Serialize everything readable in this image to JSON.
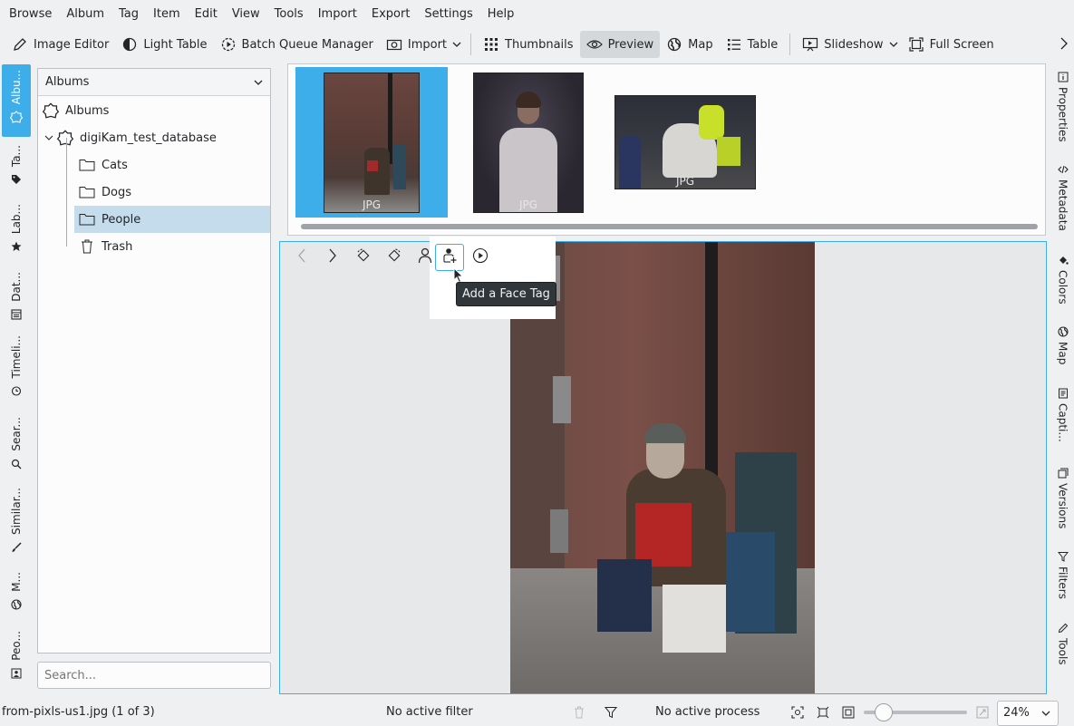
{
  "menu": [
    "Browse",
    "Album",
    "Tag",
    "Item",
    "Edit",
    "View",
    "Tools",
    "Import",
    "Export",
    "Settings",
    "Help"
  ],
  "toolbar": {
    "image_editor": "Image Editor",
    "light_table": "Light Table",
    "batch_queue": "Batch Queue Manager",
    "import": "Import",
    "thumbnails": "Thumbnails",
    "preview": "Preview",
    "map": "Map",
    "table": "Table",
    "slideshow": "Slideshow",
    "full_screen": "Full Screen"
  },
  "left_tabs": [
    "Albu...",
    "Ta...",
    "Lab...",
    "Dat...",
    "Timeli...",
    "Sear...",
    "Similar...",
    "M...",
    "Peo..."
  ],
  "album_panel": {
    "combo_label": "Albums",
    "tree": {
      "root": "Albums",
      "database": "digiKam_test_database",
      "cats": "Cats",
      "dogs": "Dogs",
      "people": "People",
      "trash": "Trash"
    },
    "search_placeholder": "Search..."
  },
  "thumbnails": [
    {
      "label": "JPG",
      "selected": true
    },
    {
      "label": "JPG",
      "selected": false
    },
    {
      "label": "JPG",
      "selected": false
    }
  ],
  "viewer": {
    "tooltip": "Add a Face Tag"
  },
  "right_tabs": [
    "Properties",
    "Metadata",
    "Colors",
    "Map",
    "Capti...",
    "Versions",
    "Filters",
    "Tools"
  ],
  "status": {
    "file": "from-pixls-us1.jpg (1 of 3)",
    "filter": "No active filter",
    "process": "No active process",
    "zoom": "24%",
    "zoom_level": 0.13
  },
  "colors": {
    "accent": "#3daee9",
    "selected_row": "#c5dcec"
  }
}
